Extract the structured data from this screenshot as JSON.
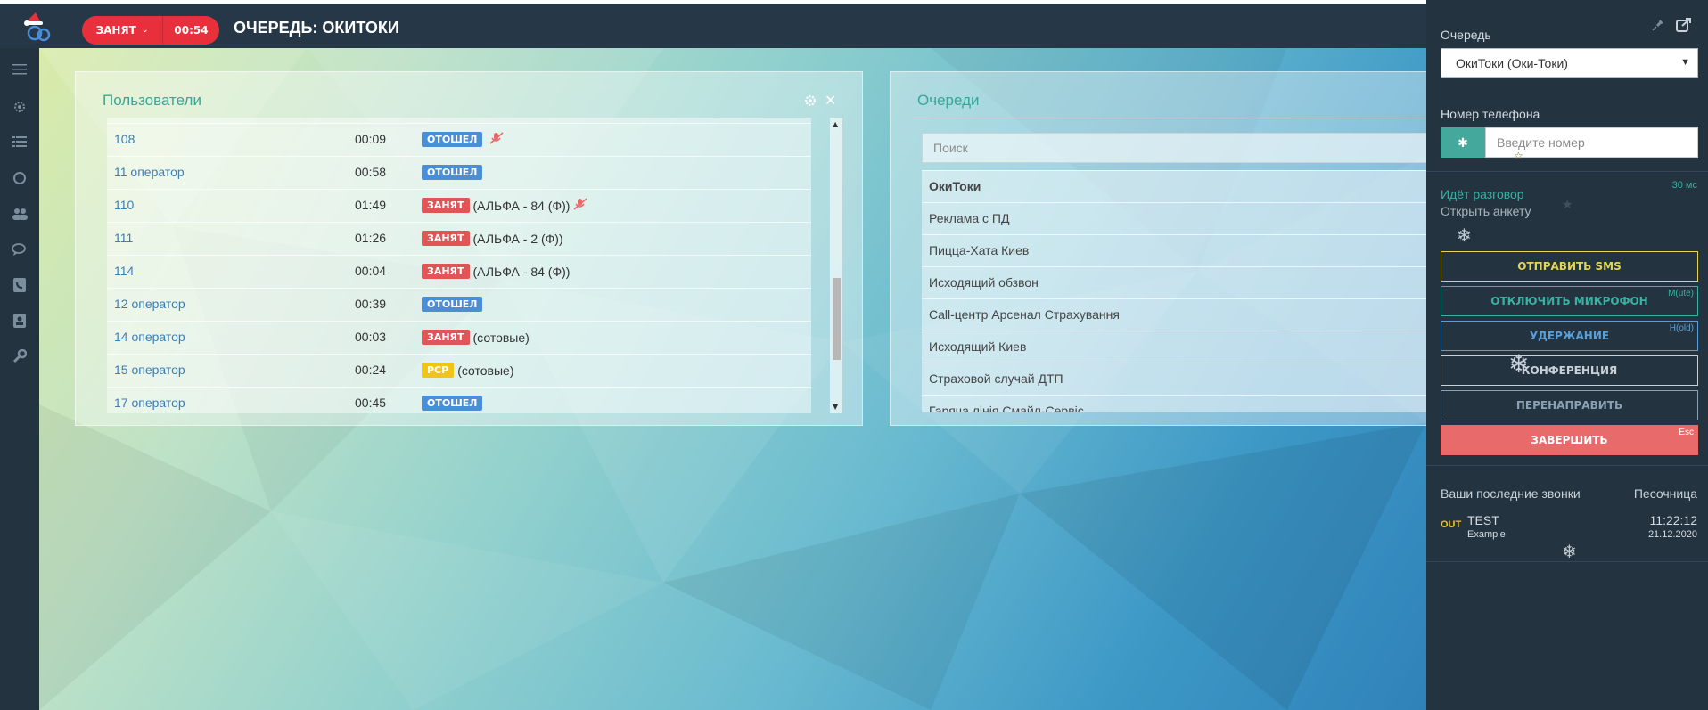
{
  "header": {
    "status_label": "ЗАНЯТ",
    "status_timer": "00:54",
    "page_title": "ОЧЕРЕДЬ: ОКИТОКИ"
  },
  "nav": {
    "icons": [
      "menu-icon",
      "gear-icon",
      "list-icon",
      "circle-icon",
      "users-icon",
      "chat-icon",
      "phone-book-icon",
      "contact-card-icon",
      "wrench-icon"
    ]
  },
  "users_panel": {
    "title": "Пользователи",
    "rows": [
      {
        "name": "108",
        "time": "00:09",
        "badge": "ОТОШЕЛ",
        "badge_color": "#4a8fd6",
        "extra": "",
        "mic_off": true
      },
      {
        "name": "11 оператор",
        "time": "00:58",
        "badge": "ОТОШЕЛ",
        "badge_color": "#4a8fd6",
        "extra": "",
        "mic_off": false
      },
      {
        "name": "110",
        "time": "01:49",
        "badge": "ЗАНЯТ",
        "badge_color": "#e05656",
        "extra": "(АЛЬФА - 84 (Ф))",
        "mic_off": true
      },
      {
        "name": "111",
        "time": "01:26",
        "badge": "ЗАНЯТ",
        "badge_color": "#e05656",
        "extra": "(АЛЬФА - 2 (Ф))",
        "mic_off": false
      },
      {
        "name": "114",
        "time": "00:04",
        "badge": "ЗАНЯТ",
        "badge_color": "#e05656",
        "extra": "(АЛЬФА - 84 (Ф))",
        "mic_off": false
      },
      {
        "name": "12 оператор",
        "time": "00:39",
        "badge": "ОТОШЕЛ",
        "badge_color": "#4a8fd6",
        "extra": "",
        "mic_off": false
      },
      {
        "name": "14 оператор",
        "time": "00:03",
        "badge": "ЗАНЯТ",
        "badge_color": "#e05656",
        "extra": "(сотовые)",
        "mic_off": false
      },
      {
        "name": "15 оператор",
        "time": "00:24",
        "badge": "РСР",
        "badge_color": "#f0c419",
        "extra": "(сотовые)",
        "mic_off": false
      },
      {
        "name": "17 оператор",
        "time": "00:45",
        "badge": "ОТОШЕЛ",
        "badge_color": "#4a8fd6",
        "extra": "",
        "mic_off": false
      }
    ]
  },
  "queues_panel": {
    "title": "Очереди",
    "search_placeholder": "Поиск",
    "items": [
      {
        "label": "ОкиТоки",
        "bold": true
      },
      {
        "label": "Реклама с ПД",
        "bold": false
      },
      {
        "label": "Пицца-Хата Киев",
        "bold": false
      },
      {
        "label": "Исходящий обзвон",
        "bold": false
      },
      {
        "label": "Call-центр Арсенал Страхування",
        "bold": false
      },
      {
        "label": "Исходящий Киев",
        "bold": false
      },
      {
        "label": "Страховой случай ДТП",
        "bold": false
      },
      {
        "label": "Гаряча лінія Смайл-Сервіс",
        "bold": false
      }
    ]
  },
  "side": {
    "queue_label": "Очередь",
    "queue_value": "ОкиТоки (Оки-Токи)",
    "phone_label": "Номер телефона",
    "phone_button": "✱",
    "phone_placeholder": "Введите номер",
    "call_status": "Идёт разговор",
    "call_duration": "30 мс",
    "open_form": "Открыть анкету",
    "buttons": [
      {
        "label": "ОТПРАВИТЬ SMS",
        "color": "#e1d456",
        "hotkey": ""
      },
      {
        "label": "ОТКЛЮЧИТЬ МИКРОФОН",
        "color": "#3ab1a1",
        "hotkey": "M(ute)"
      },
      {
        "label": "УДЕРЖАНИЕ",
        "color": "#5a9fd8",
        "hotkey": "H(old)"
      },
      {
        "label": "КОНФЕРЕНЦИЯ",
        "color": "#c9d1d8",
        "hotkey": ""
      },
      {
        "label": "ПЕРЕНАПРАВИТЬ",
        "color": "#8aa0b3",
        "hotkey": ""
      },
      {
        "label": "ЗАВЕРШИТЬ",
        "color": "#e86a6a",
        "hotkey": "Esc"
      }
    ],
    "recent_title": "Ваши последние звонки",
    "sandbox_label": "Песочница",
    "recent": {
      "direction": "OUT",
      "name": "TEST",
      "sub": "Example",
      "time": "11:22:12",
      "date": "21.12.2020"
    }
  }
}
